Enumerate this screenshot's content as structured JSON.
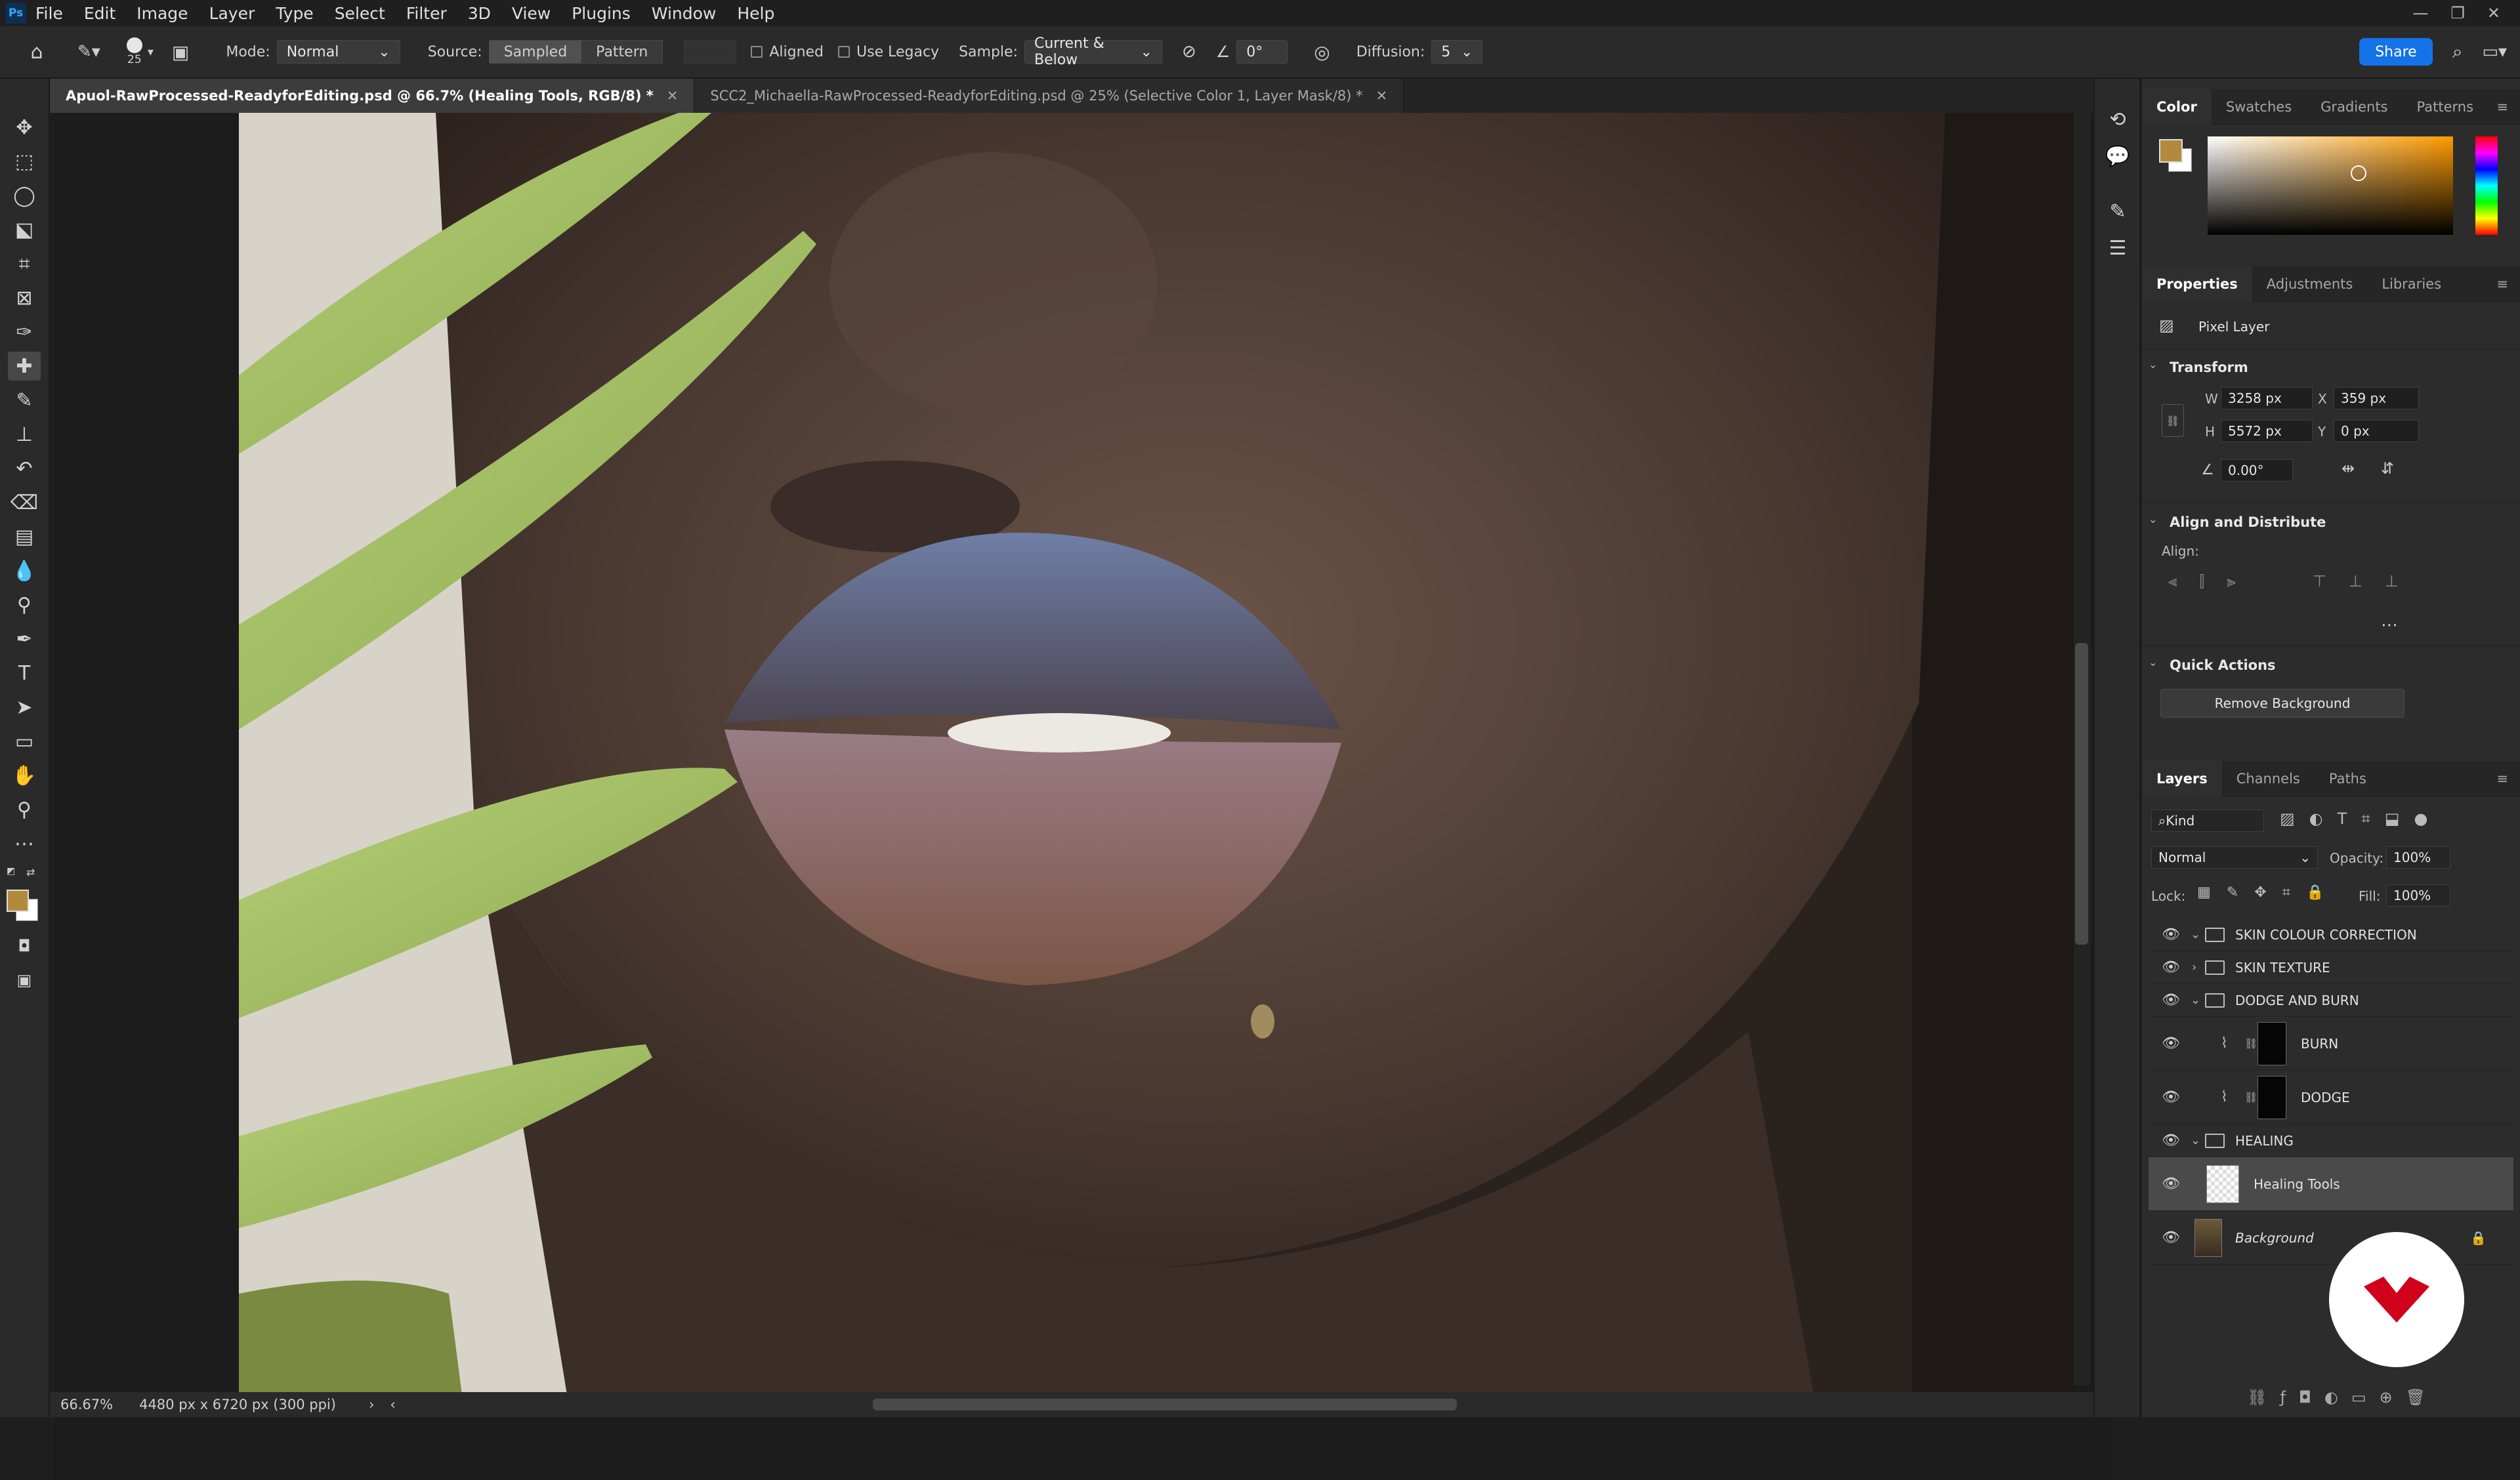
{
  "menubar": {
    "logo": "Ps",
    "items": [
      "File",
      "Edit",
      "Image",
      "Layer",
      "Type",
      "Select",
      "Filter",
      "3D",
      "View",
      "Plugins",
      "Window",
      "Help"
    ]
  },
  "options": {
    "brush_size": "25",
    "mode_label": "Mode:",
    "mode_value": "Normal",
    "source_label": "Source:",
    "source_sampled": "Sampled",
    "source_pattern": "Pattern",
    "aligned": "Aligned",
    "use_legacy": "Use Legacy",
    "sample_label": "Sample:",
    "sample_value": "Current & Below",
    "angle_value": "0°",
    "diffusion_label": "Diffusion:",
    "diffusion_value": "5",
    "share": "Share"
  },
  "tabs": [
    {
      "label": "Apuol-RawProcessed-ReadyforEditing.psd @ 66.7% (Healing Tools, RGB/8) *"
    },
    {
      "label": "SCC2_Michaella-RawProcessed-ReadyforEditing.psd @ 25% (Selective Color 1, Layer Mask/8) *"
    }
  ],
  "status": {
    "zoom": "66.67%",
    "doc_info": "4480 px x 6720 px (300 ppi)"
  },
  "color_panel": {
    "tabs": [
      "Color",
      "Swatches",
      "Gradients",
      "Patterns"
    ],
    "foreground": "#b38a3c",
    "background": "#ffffff"
  },
  "properties": {
    "tabs": [
      "Properties",
      "Adjustments",
      "Libraries"
    ],
    "layer_type": "Pixel Layer",
    "transform_title": "Transform",
    "w_label": "W",
    "w_value": "3258 px",
    "h_label": "H",
    "h_value": "5572 px",
    "x_label": "X",
    "x_value": "359 px",
    "y_label": "Y",
    "y_value": "0 px",
    "angle": "0.00°",
    "align_title": "Align and Distribute",
    "align_label": "Align:",
    "quick_actions_title": "Quick Actions",
    "remove_bg": "Remove Background"
  },
  "layers_panel": {
    "tabs": [
      "Layers",
      "Channels",
      "Paths"
    ],
    "filter_kind": "Kind",
    "blend_mode": "Normal",
    "opacity_label": "Opacity:",
    "opacity_value": "100%",
    "lock_label": "Lock:",
    "fill_label": "Fill:",
    "fill_value": "100%",
    "layers": [
      {
        "name": "SKIN COLOUR CORRECTION"
      },
      {
        "name": "SKIN TEXTURE"
      },
      {
        "name": "DODGE AND BURN"
      },
      {
        "name": "BURN"
      },
      {
        "name": "DODGE"
      },
      {
        "name": "HEALING"
      },
      {
        "name": "Healing Tools"
      },
      {
        "name": "Background"
      }
    ]
  }
}
